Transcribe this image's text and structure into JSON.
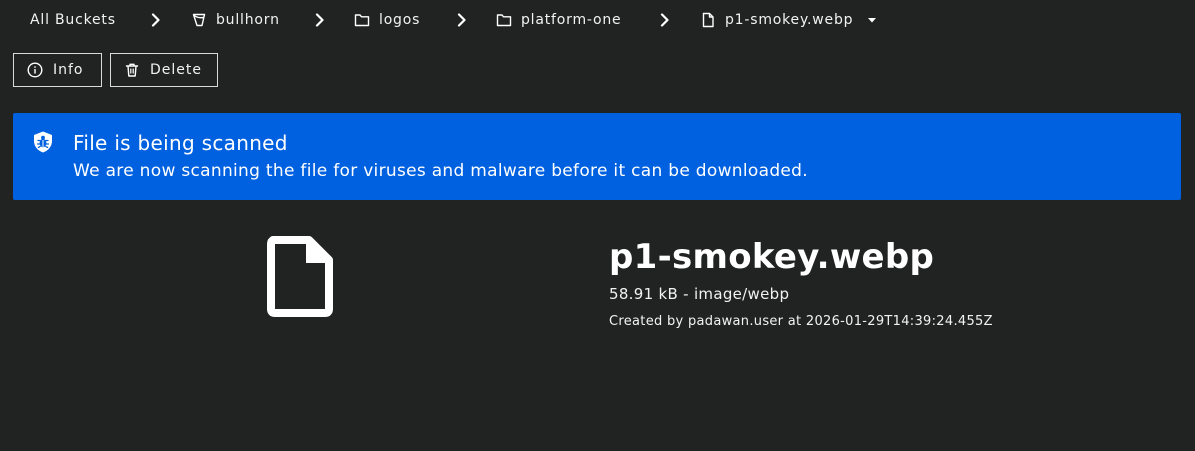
{
  "breadcrumb": {
    "root": "All Buckets",
    "bucket": "bullhorn",
    "folder1": "logos",
    "folder2": "platform-one",
    "file": "p1-smokey.webp"
  },
  "toolbar": {
    "info_label": "Info",
    "delete_label": "Delete"
  },
  "alert": {
    "title": "File is being scanned",
    "message": "We are now scanning the file for viruses and malware before it can be downloaded.",
    "color": "#0061e0"
  },
  "file": {
    "name": "p1-smokey.webp",
    "size": "58.91 kB",
    "separator": " - ",
    "mime": "image/webp",
    "created_prefix": "Created by ",
    "created_by": "padawan.user",
    "created_at_prefix": " at ",
    "created_at": "2026-01-29T14:39:24.455Z"
  },
  "icons": {
    "bucket": "bucket-icon",
    "folder": "folder-icon",
    "file": "file-icon",
    "dropdown": "caret-down-icon",
    "info": "info-icon",
    "delete": "trash-icon",
    "scan": "shield-bug-icon",
    "preview": "file-icon"
  },
  "colors": {
    "background": "#202322",
    "alert": "#0061e0",
    "text": "#ffffff"
  }
}
